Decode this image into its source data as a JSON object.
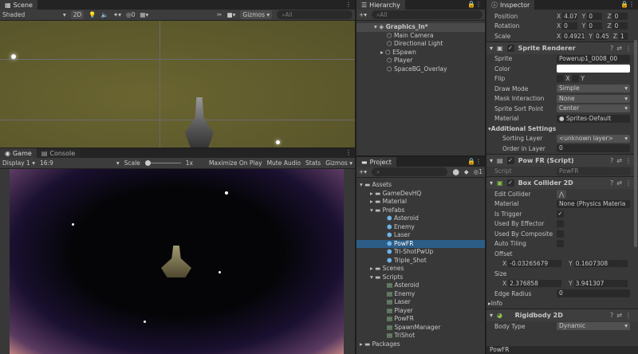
{
  "scene": {
    "tab": "Scene",
    "shading": "Shaded",
    "mode_2d": "2D",
    "hidden_count": "0",
    "gizmos": "Gizmos",
    "search_placeholder": "All"
  },
  "game": {
    "tabs": [
      "Game",
      "Console"
    ],
    "display": "Display 1",
    "aspect": "16:9",
    "scale_label": "Scale",
    "scale_value": "1x",
    "buttons": [
      "Maximize On Play",
      "Mute Audio",
      "Stats",
      "Gizmos"
    ]
  },
  "hierarchy": {
    "tab": "Hierarchy",
    "search_placeholder": "All",
    "scene_name": "Graphics_In*",
    "items": [
      "Main Camera",
      "Directional Light",
      "ESpawn",
      "Player",
      "SpaceBG_Overlay"
    ]
  },
  "project": {
    "tab": "Project",
    "badge": "1",
    "tree": [
      {
        "label": "Assets",
        "depth": 0,
        "type": "folder"
      },
      {
        "label": "GameDevHQ",
        "depth": 1,
        "type": "folder"
      },
      {
        "label": "Material",
        "depth": 1,
        "type": "folder"
      },
      {
        "label": "Prefabs",
        "depth": 1,
        "type": "folder"
      },
      {
        "label": "Asteroid",
        "depth": 2,
        "type": "prefab"
      },
      {
        "label": "Enemy",
        "depth": 2,
        "type": "prefab"
      },
      {
        "label": "Laser",
        "depth": 2,
        "type": "prefab"
      },
      {
        "label": "PowFR",
        "depth": 2,
        "type": "prefab",
        "selected": true
      },
      {
        "label": "Tri-ShotPwUp",
        "depth": 2,
        "type": "prefab"
      },
      {
        "label": "Triple_Shot",
        "depth": 2,
        "type": "prefab"
      },
      {
        "label": "Scenes",
        "depth": 1,
        "type": "folder"
      },
      {
        "label": "Scripts",
        "depth": 1,
        "type": "folder"
      },
      {
        "label": "Asteroid",
        "depth": 2,
        "type": "script"
      },
      {
        "label": "Enemy",
        "depth": 2,
        "type": "script"
      },
      {
        "label": "Laser",
        "depth": 2,
        "type": "script"
      },
      {
        "label": "Player",
        "depth": 2,
        "type": "script"
      },
      {
        "label": "PowFR",
        "depth": 2,
        "type": "script"
      },
      {
        "label": "SpawnManager",
        "depth": 2,
        "type": "script"
      },
      {
        "label": "TriShot",
        "depth": 2,
        "type": "script"
      },
      {
        "label": "Packages",
        "depth": 0,
        "type": "folder"
      }
    ]
  },
  "inspector": {
    "tab": "Inspector",
    "transform": {
      "position": {
        "label": "Position",
        "x": "4.07",
        "y": "0",
        "z": "0"
      },
      "rotation": {
        "label": "Rotation",
        "x": "0",
        "y": "0",
        "z": "0"
      },
      "scale": {
        "label": "Scale",
        "x": "0.4921",
        "y": "0.45",
        "z": "1"
      }
    },
    "sprite_renderer": {
      "title": "Sprite Renderer",
      "sprite_label": "Sprite",
      "sprite": "Powerup1_0008_00",
      "color_label": "Color",
      "flip_label": "Flip",
      "flip_x": "X",
      "flip_y": "Y",
      "draw_mode_label": "Draw Mode",
      "draw_mode": "Simple",
      "mask_label": "Mask Interaction",
      "mask": "None",
      "sort_point_label": "Sprite Sort Point",
      "sort_point": "Center",
      "material_label": "Material",
      "material": "Sprites-Default",
      "additional": "Additional Settings",
      "sorting_layer_label": "Sorting Layer",
      "sorting_layer": "<unknown layer>",
      "order_label": "Order in Layer",
      "order": "0"
    },
    "pow_script": {
      "title": "Pow FR (Script)",
      "script_label": "Script",
      "script": "PowFR"
    },
    "box_collider": {
      "title": "Box Collider 2D",
      "edit_label": "Edit Collider",
      "material_label": "Material",
      "material": "None (Physics Materia",
      "trigger_label": "Is Trigger",
      "effector_label": "Used By Effector",
      "composite_label": "Used By Composite",
      "tiling_label": "Auto Tiling",
      "offset_label": "Offset",
      "offset_x": "-0.03265679",
      "offset_y": "0.1607308",
      "size_label": "Size",
      "size_x": "2.376858",
      "size_y": "3.941307",
      "edge_label": "Edge Radius",
      "edge": "0",
      "info_label": "Info"
    },
    "rigidbody": {
      "title": "Rigidbody 2D",
      "body_type_label": "Body Type",
      "body_type": "Dynamic"
    },
    "footer": "PowFR"
  },
  "colors": {
    "scene_bg": "#5f5b2c",
    "selection": "#2c5d87",
    "accent_green": "#8bc34a"
  }
}
